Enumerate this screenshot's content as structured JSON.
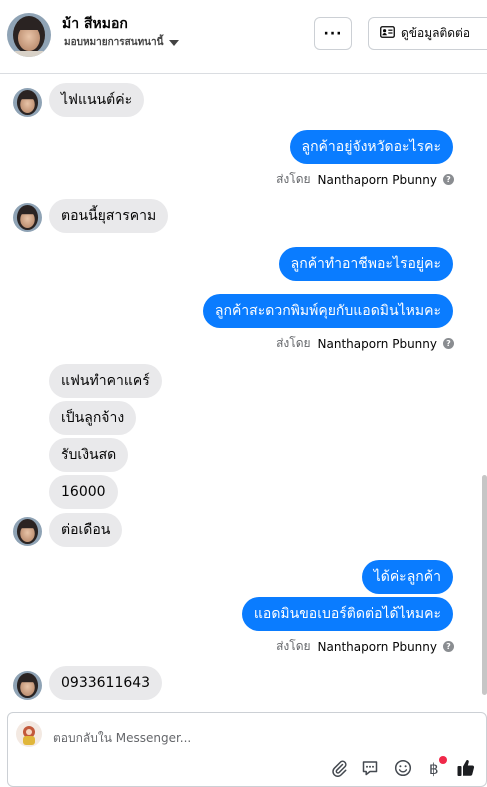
{
  "header": {
    "contact_name": "ม้า สีหมอก",
    "assignment_label": "มอบหมายการสนทนานี้",
    "more_label": "···",
    "contact_info_label": "ดูข้อมูลติดต่อ"
  },
  "messages": [
    {
      "text": "ไฟแนนต์ค่ะ",
      "direction": "incoming"
    },
    {
      "text": "ลูกค้าอยู่จังหวัดอะไรคะ",
      "direction": "outgoing"
    },
    {
      "text": "ตอนนี้ยุสารคาม",
      "direction": "incoming"
    },
    {
      "text": "ลูกค้าทำอาชีพอะไรอยู่คะ",
      "direction": "outgoing"
    },
    {
      "text": "ลูกค้าสะดวกพิมพ์คุยกับแอดมินไหมคะ",
      "direction": "outgoing"
    },
    {
      "text": "แฟนทำคาแคร์",
      "direction": "incoming"
    },
    {
      "text": "เป็นลูกจ้าง",
      "direction": "incoming"
    },
    {
      "text": "รับเงินสด",
      "direction": "incoming"
    },
    {
      "text": "16000",
      "direction": "incoming"
    },
    {
      "text": "ต่อเดือน",
      "direction": "incoming"
    },
    {
      "text": "ได้ค่ะลูกค้า",
      "direction": "outgoing"
    },
    {
      "text": "แอดมินขอเบอร์ติดต่อได้ไหมคะ",
      "direction": "outgoing"
    },
    {
      "text": "0933611643",
      "direction": "incoming"
    }
  ],
  "sent_by": {
    "prefix": "ส่งโดย",
    "agent": "Nanthaporn Pbunny"
  },
  "composer": {
    "placeholder": "ตอบกลับใน Messenger..."
  },
  "icons": {
    "attach": "paperclip-icon",
    "saved_replies": "saved-replies-icon",
    "emoji": "emoji-icon",
    "payment": "baht-payment-icon",
    "like": "thumbs-up-icon",
    "more": "ellipsis-icon",
    "contact_card": "contact-card-icon",
    "caret": "caret-down-icon",
    "info": "info-icon"
  },
  "colors": {
    "outgoing_bubble": "#0a7cff",
    "incoming_bubble": "#e9e9eb",
    "notification_dot": "#f02849"
  }
}
